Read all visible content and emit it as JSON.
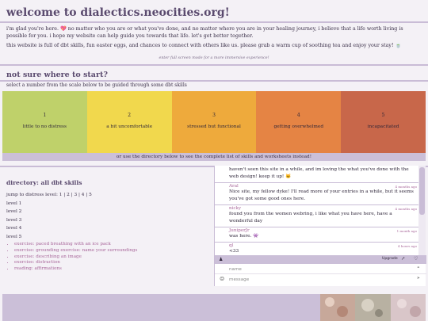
{
  "header": {
    "title": "welcome to dialectics.neocities.org!",
    "intro": "i'm glad you're here. 💖 no matter who you are or what you've done, and no matter where you are in your healing journey, i believe that a life worth living is possible for you. i hope my website can help guide you towards that life. let's get better together.",
    "intro2": "this website is full of dbt skills, fun easter eggs, and chances to connect with others like us. please grab a warm cup of soothing tea and enjoy your stay! 🍵",
    "fullscreen_note": "enter full screen mode for a more immersive experience!"
  },
  "start": {
    "title": "not sure where to start?",
    "subtitle": "select a number from the scale below to be guided through some dbt skills",
    "scale": [
      {
        "num": "1",
        "label": "little to no distress",
        "color": "#bfd16a"
      },
      {
        "num": "2",
        "label": "a bit uncomfortable",
        "color": "#f1d84d"
      },
      {
        "num": "3",
        "label": "stressed but functional",
        "color": "#eeaa3c"
      },
      {
        "num": "4",
        "label": "getting overwhelmed",
        "color": "#e58444"
      },
      {
        "num": "5",
        "label": "incapacitated",
        "color": "#c8674a"
      }
    ],
    "directory_bar": "or use the directory below to see the complete list of skills and worksheets instead!"
  },
  "directory": {
    "title": "directory: all dbt skills",
    "jump_prefix": "jump to distress level:",
    "jump_levels": [
      "1",
      "2",
      "3",
      "4",
      "5"
    ],
    "levels": [
      "level 1",
      "level 2",
      "level 3",
      "level 4",
      "level 5"
    ],
    "exercises": [
      "exercise: paced breathing with an ice pack",
      "exercise: grounding exercise: name your surroundings",
      "exercise: describing an image",
      "exercise: distraction",
      "reading: affirmations"
    ]
  },
  "chat": {
    "messages": [
      {
        "name": "",
        "time": "",
        "text": "haven't seen this site in a while, and im loving the what you've done with the web design! keep it up! 🐱"
      },
      {
        "name": "Aral",
        "time": "4 months ago",
        "text": "Nice site, my fellow dyke! I'll read more of your entries in a while, but it seems you've got some good ones here."
      },
      {
        "name": "nicky",
        "time": "4 months ago",
        "text": "found you from the women webring, i like what you have here, have a wonderful day"
      },
      {
        "name": "JuniperJr",
        "time": "1 month ago",
        "text": "was here. 👾"
      },
      {
        "name": "ql",
        "time": "4 hours ago",
        "text": "<33"
      }
    ],
    "upgrade_label": "Upgrade",
    "name_placeholder": "name",
    "message_placeholder": "message"
  },
  "icons": {
    "user": "user-icon",
    "popout": "popout-icon",
    "heart": "heart-icon",
    "emoji": "emoji-icon",
    "key": "key-icon",
    "send": "send-icon"
  },
  "colors": {
    "accent": "#5a4a6e",
    "rule": "#c9bcd6",
    "bar": "#cbbfd8",
    "link": "#a8669a"
  }
}
